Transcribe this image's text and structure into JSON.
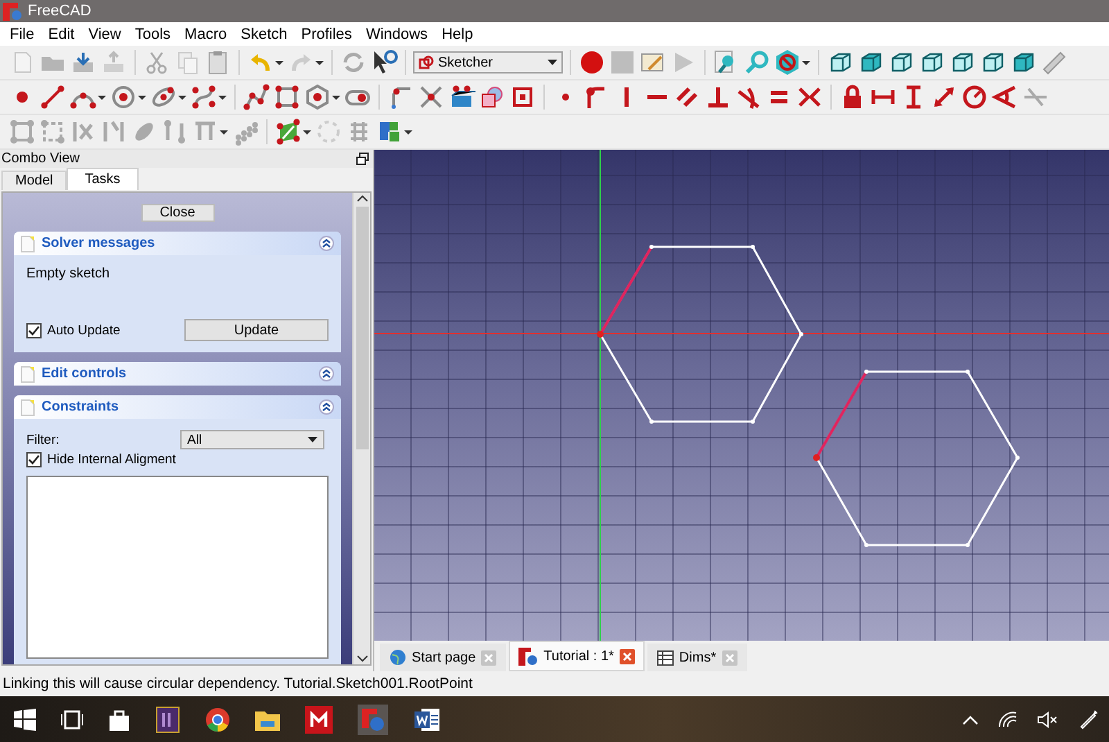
{
  "window": {
    "title": "FreeCAD"
  },
  "menu": [
    "File",
    "Edit",
    "View",
    "Tools",
    "Macro",
    "Sketch",
    "Profiles",
    "Windows",
    "Help"
  ],
  "toolbar": {
    "workbench": "Sketcher"
  },
  "combo_view": {
    "title": "Combo View",
    "tabs": [
      {
        "label": "Model",
        "selected": false
      },
      {
        "label": "Tasks",
        "selected": true
      }
    ],
    "close_button": "Close",
    "panels": [
      {
        "kind": "solver",
        "title": "Solver messages",
        "message": "Empty sketch",
        "auto_update": {
          "label": "Auto Update",
          "checked": true
        },
        "button": "Update"
      },
      {
        "kind": "edit",
        "title": "Edit controls"
      },
      {
        "kind": "constraints",
        "title": "Constraints",
        "filter_label": "Filter:",
        "filter_value": "All",
        "hide_internal": {
          "label": "Hide Internal Aligment",
          "checked": true
        }
      }
    ]
  },
  "document_tabs": [
    {
      "label": "Start page",
      "kind": "web",
      "selected": false
    },
    {
      "label": "Tutorial : 1*",
      "kind": "document",
      "selected": true
    },
    {
      "label": "Dims*",
      "kind": "spreadsheet",
      "selected": false
    }
  ],
  "status_bar": "Linking this will cause circular dependency. Tutorial.Sketch001.RootPoint"
}
